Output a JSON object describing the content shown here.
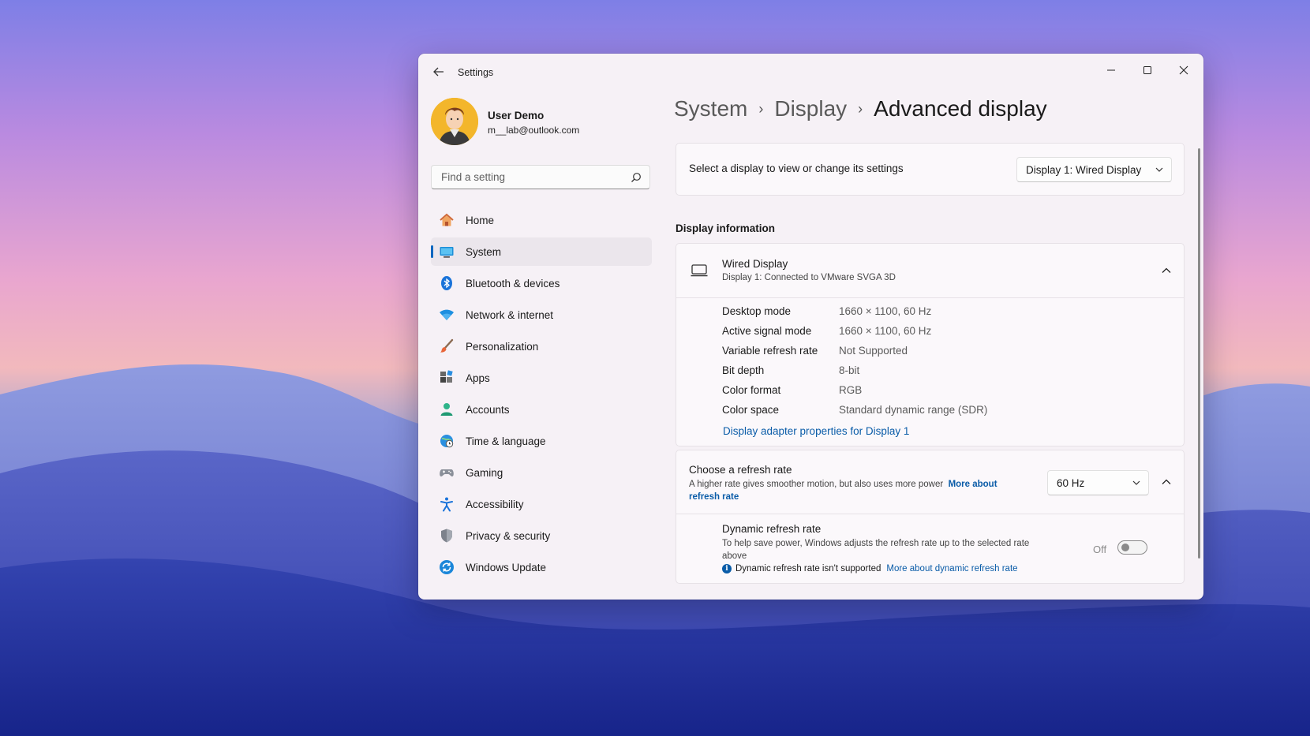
{
  "window": {
    "title": "Settings"
  },
  "profile": {
    "name": "User Demo",
    "email": "m__lab@outlook.com"
  },
  "search": {
    "placeholder": "Find a setting"
  },
  "nav": {
    "items": [
      {
        "label": "Home",
        "icon": "home-icon"
      },
      {
        "label": "System",
        "icon": "system-icon",
        "active": true
      },
      {
        "label": "Bluetooth & devices",
        "icon": "bluetooth-icon"
      },
      {
        "label": "Network & internet",
        "icon": "wifi-icon"
      },
      {
        "label": "Personalization",
        "icon": "brush-icon"
      },
      {
        "label": "Apps",
        "icon": "apps-icon"
      },
      {
        "label": "Accounts",
        "icon": "accounts-icon"
      },
      {
        "label": "Time & language",
        "icon": "globe-clock-icon"
      },
      {
        "label": "Gaming",
        "icon": "gamepad-icon"
      },
      {
        "label": "Accessibility",
        "icon": "accessibility-icon"
      },
      {
        "label": "Privacy & security",
        "icon": "shield-icon"
      },
      {
        "label": "Windows Update",
        "icon": "update-icon"
      }
    ]
  },
  "breadcrumb": {
    "level1": "System",
    "level2": "Display",
    "current": "Advanced display"
  },
  "display_select": {
    "label": "Select a display to view or change its settings",
    "value": "Display 1: Wired Display"
  },
  "display_info": {
    "heading": "Display information",
    "title": "Wired Display",
    "subtitle": "Display 1: Connected to VMware SVGA 3D",
    "rows": [
      {
        "key": "Desktop mode",
        "value": "1660 × 1100, 60 Hz"
      },
      {
        "key": "Active signal mode",
        "value": "1660 × 1100, 60 Hz"
      },
      {
        "key": "Variable refresh rate",
        "value": "Not Supported"
      },
      {
        "key": "Bit depth",
        "value": "8-bit"
      },
      {
        "key": "Color format",
        "value": "RGB"
      },
      {
        "key": "Color space",
        "value": "Standard dynamic range (SDR)"
      }
    ],
    "adapter_link": "Display adapter properties for Display 1"
  },
  "refresh": {
    "title": "Choose a refresh rate",
    "description": "A higher rate gives smoother motion, but also uses more power",
    "more_link": "More about refresh rate",
    "value": "60 Hz",
    "dynamic": {
      "title": "Dynamic refresh rate",
      "description": "To help save power, Windows adjusts the refresh rate up to the selected rate above",
      "note": "Dynamic refresh rate isn't supported",
      "more_link": "More about dynamic refresh rate",
      "toggle_state": "Off",
      "enabled": false
    }
  },
  "colors": {
    "accent": "#0067c0",
    "link": "#0a5ca8"
  }
}
